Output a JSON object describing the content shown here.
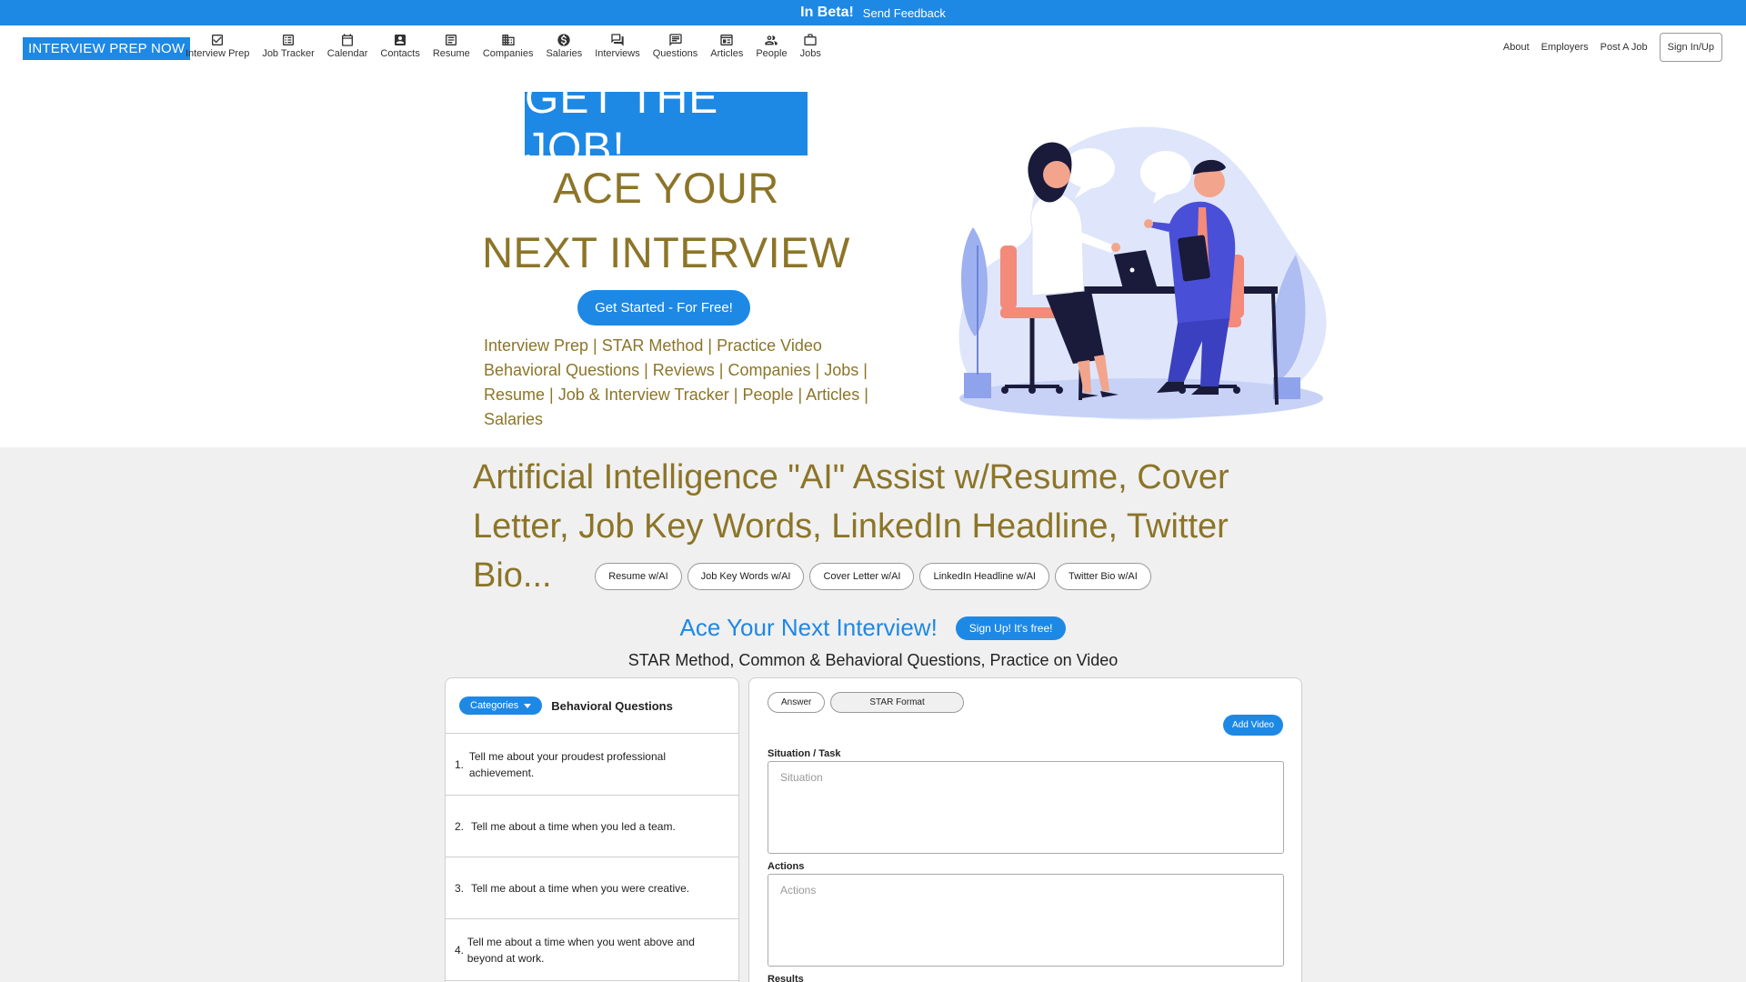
{
  "beta": {
    "title": "In Beta!",
    "feedback": "Send Feedback"
  },
  "brand": "INTERVIEW PREP NOW",
  "nav": {
    "items": [
      {
        "label": "Interview Prep",
        "icon": "checkbox-icon"
      },
      {
        "label": "Job Tracker",
        "icon": "list-icon"
      },
      {
        "label": "Calendar",
        "icon": "calendar-icon"
      },
      {
        "label": "Contacts",
        "icon": "contact-icon"
      },
      {
        "label": "Resume",
        "icon": "document-icon"
      },
      {
        "label": "Companies",
        "icon": "building-icon"
      },
      {
        "label": "Salaries",
        "icon": "dollar-icon"
      },
      {
        "label": "Interviews",
        "icon": "chat-icon"
      },
      {
        "label": "Questions",
        "icon": "comment-icon"
      },
      {
        "label": "Articles",
        "icon": "article-icon"
      },
      {
        "label": "People",
        "icon": "people-icon"
      },
      {
        "label": "Jobs",
        "icon": "briefcase-icon"
      }
    ],
    "right": {
      "about": "About",
      "employers": "Employers",
      "post_job": "Post A Job",
      "signin": "Sign In/Up"
    }
  },
  "hero": {
    "badge": "GET THE JOB!",
    "line1": "ACE YOUR",
    "line2": "NEXT INTERVIEW",
    "cta": "Get Started - For Free!",
    "links": "Interview Prep | STAR Method | Practice Video Behavioral Questions | Reviews | Companies | Jobs | Resume | Job & Interview Tracker | People | Articles | Salaries"
  },
  "ai": {
    "headline": "Artificial Intelligence \"AI\" Assist w/Resume, Cover Letter, Job Key Words, LinkedIn Headline, Twitter Bio...",
    "pills": [
      "Resume w/AI",
      "Job Key Words w/AI",
      "Cover Letter w/AI",
      "LinkedIn Headline w/AI",
      "Twitter Bio w/AI"
    ]
  },
  "ace_section": {
    "title": "Ace Your Next Interview!",
    "signup": "Sign Up! It's free!",
    "subtitle": "STAR Method, Common & Behavioral Questions, Practice on Video"
  },
  "questions": {
    "categories_label": "Categories",
    "title": "Behavioral Questions",
    "items": [
      {
        "num": "1.",
        "text": "Tell me about your proudest professional achievement."
      },
      {
        "num": "2.",
        "text": "Tell me about a time when you led a team."
      },
      {
        "num": "3.",
        "text": "Tell me about a time when you were creative."
      },
      {
        "num": "4.",
        "text": "Tell me about a time when you went above and beyond at work."
      }
    ]
  },
  "answer": {
    "tab_answer": "Answer",
    "tab_star": "STAR Format",
    "add_video": "Add Video",
    "situation_label": "Situation / Task",
    "situation_placeholder": "Situation",
    "actions_label": "Actions",
    "actions_placeholder": "Actions",
    "results_label": "Results"
  },
  "colors": {
    "accent": "#1e88e5",
    "gold": "#8c7528",
    "grey_bg": "#f0f0f0"
  }
}
